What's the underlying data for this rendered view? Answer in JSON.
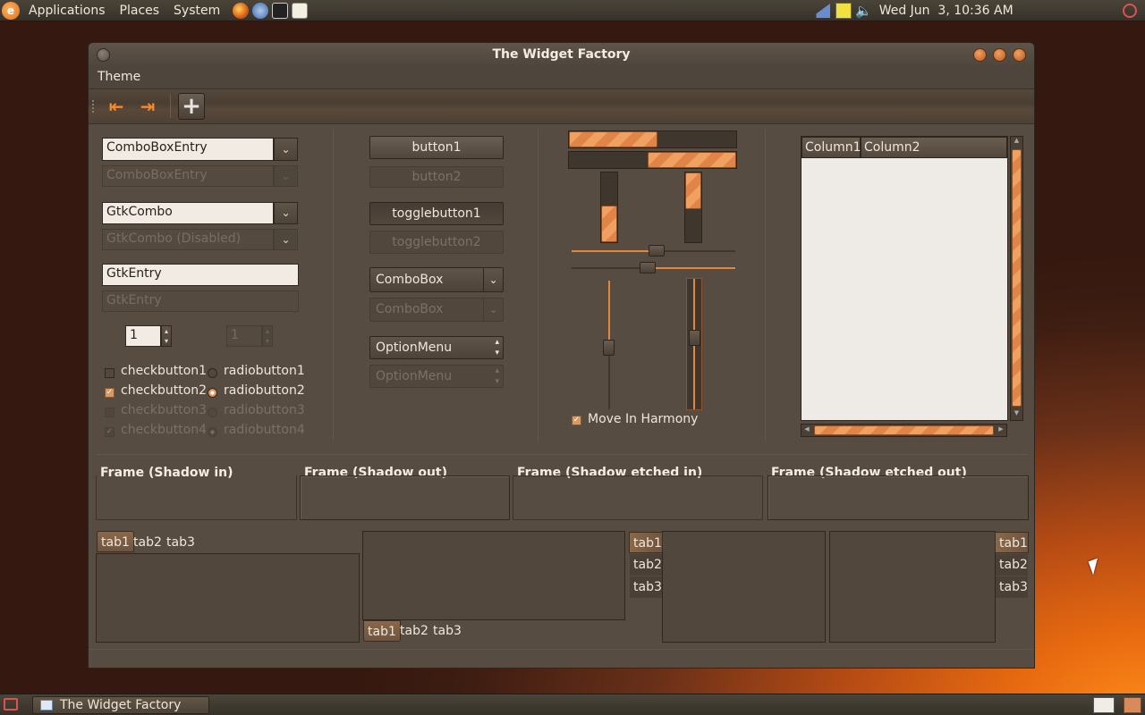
{
  "panel": {
    "menus": [
      "Applications",
      "Places",
      "System"
    ],
    "clock": "Wed Jun  3, 10:36 AM",
    "taskbar_window": "The Widget Factory"
  },
  "window": {
    "title": "The Widget Factory",
    "menu": "Theme"
  },
  "left": {
    "combo_entry": "ComboBoxEntry",
    "combo_entry_disabled": "ComboBoxEntry",
    "gtk_combo": "GtkCombo",
    "gtk_combo_disabled": "GtkCombo (Disabled)",
    "entry": "GtkEntry",
    "entry_disabled": "GtkEntry",
    "spin1": "1",
    "spin2": "1",
    "checks": [
      {
        "label": "checkbutton1",
        "checked": false,
        "disabled": false
      },
      {
        "label": "checkbutton2",
        "checked": true,
        "disabled": false
      },
      {
        "label": "checkbutton3",
        "checked": false,
        "disabled": true
      },
      {
        "label": "checkbutton4",
        "checked": true,
        "disabled": true
      }
    ],
    "radios": [
      {
        "label": "radiobutton1",
        "checked": false,
        "disabled": false
      },
      {
        "label": "radiobutton2",
        "checked": true,
        "disabled": false
      },
      {
        "label": "radiobutton3",
        "checked": false,
        "disabled": true
      },
      {
        "label": "radiobutton4",
        "checked": true,
        "disabled": true
      }
    ]
  },
  "middle": {
    "button1": "button1",
    "button2": "button2",
    "toggle1": "togglebutton1",
    "toggle2": "togglebutton2",
    "combobox": "ComboBox",
    "combobox_disabled": "ComboBox",
    "optionmenu": "OptionMenu",
    "optionmenu_disabled": "OptionMenu"
  },
  "sliders": {
    "progress_h1": 0.53,
    "progress_h2": 0.53,
    "progress_v1": 0.53,
    "progress_v2": 0.53,
    "harmony_label": "Move In Harmony",
    "harmony_checked": true
  },
  "tree": {
    "columns": [
      "Column1",
      "Column2"
    ]
  },
  "frames": [
    "Frame (Shadow in)",
    "Frame (Shadow out)",
    "Frame (Shadow etched in)",
    "Frame (Shadow etched out)"
  ],
  "tabs": [
    "tab1",
    "tab2",
    "tab3"
  ]
}
